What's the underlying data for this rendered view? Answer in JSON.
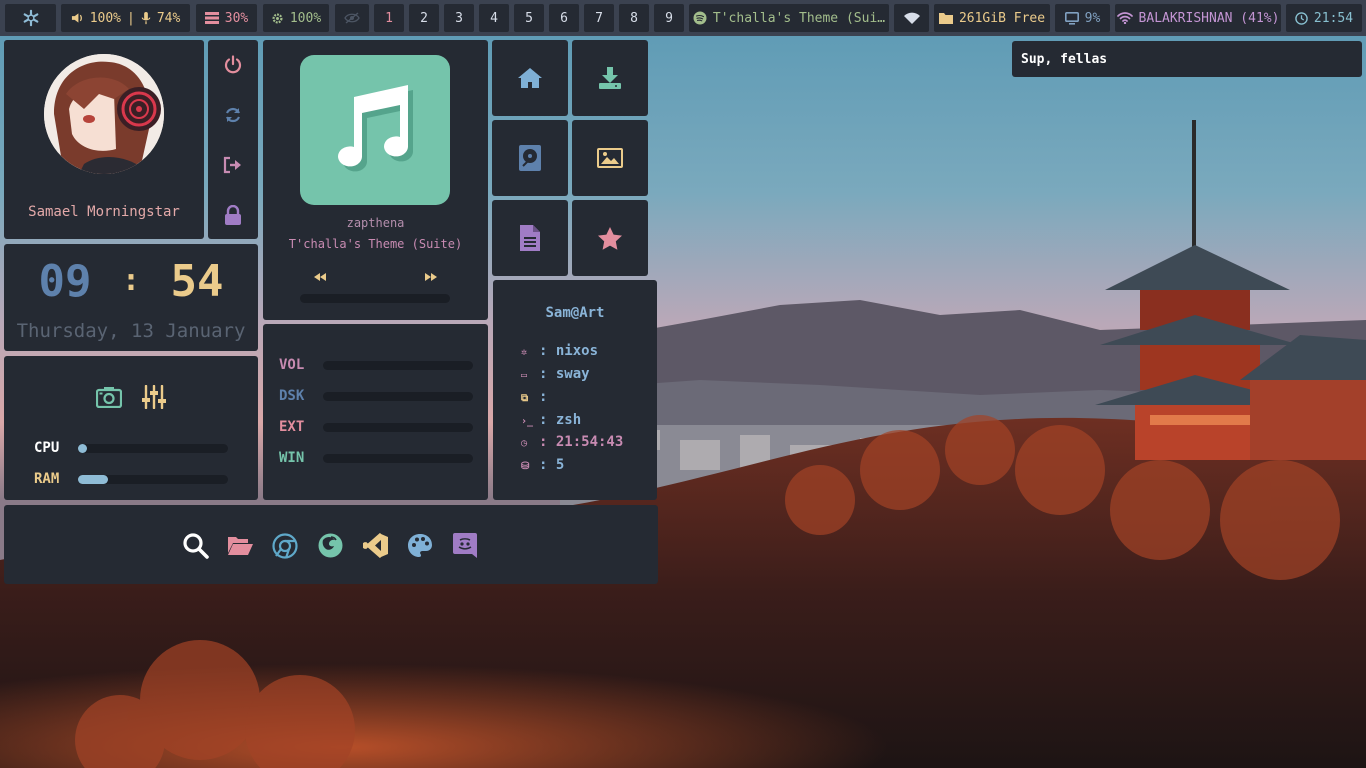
{
  "topbar": {
    "volume": "100%",
    "separator": "|",
    "mic": "74%",
    "memory": "30%",
    "cpu": "100%",
    "workspaces": [
      "1",
      "2",
      "3",
      "4",
      "5",
      "6",
      "7",
      "8",
      "9"
    ],
    "active_workspace": "1",
    "spotify_track": "T'challa's Theme (Sui…",
    "disk_free": "261GiB Free",
    "display_brightness": "9%",
    "network": "BALAKRISHNAN (41%)",
    "time": "21:54"
  },
  "notification": {
    "text": "Sup, fellas"
  },
  "profile": {
    "username": "Samael Morningstar"
  },
  "clock": {
    "hour": "09",
    "sep": ":",
    "minute": "54",
    "date": "Thursday, 13 January"
  },
  "system": {
    "items": [
      {
        "label": "CPU",
        "level": 0.03
      },
      {
        "label": "RAM",
        "level": 0.2
      }
    ]
  },
  "music": {
    "artist": "zapthena",
    "title": "T'challa's Theme (Suite)",
    "progress": 0.0
  },
  "storage": {
    "items": [
      {
        "label": "VOL",
        "level": 0.0
      },
      {
        "label": "DSK",
        "level": 0.0
      },
      {
        "label": "EXT",
        "level": 0.0
      },
      {
        "label": "WIN",
        "level": 0.0
      }
    ]
  },
  "fetch": {
    "title": "Sam@Art",
    "rows": [
      {
        "icon": "gear-icon",
        "value": ": nixos"
      },
      {
        "icon": "monitor-icon",
        "value": ": sway"
      },
      {
        "icon": "windows-icon",
        "value": ":"
      },
      {
        "icon": "terminal-icon",
        "value": ": zsh"
      },
      {
        "icon": "clock-icon",
        "value": ": 21:54:43"
      },
      {
        "icon": "package-icon",
        "value": ": 5"
      }
    ]
  },
  "colors": {
    "bar_bg": "#3b4250",
    "panel_bg": "#252a33",
    "accent_blue": "#5e81ac",
    "accent_yellow": "#ebcb8b",
    "accent_pink": "#e38e9e",
    "accent_green": "#a3be8c",
    "accent_purple": "#b48ead"
  }
}
